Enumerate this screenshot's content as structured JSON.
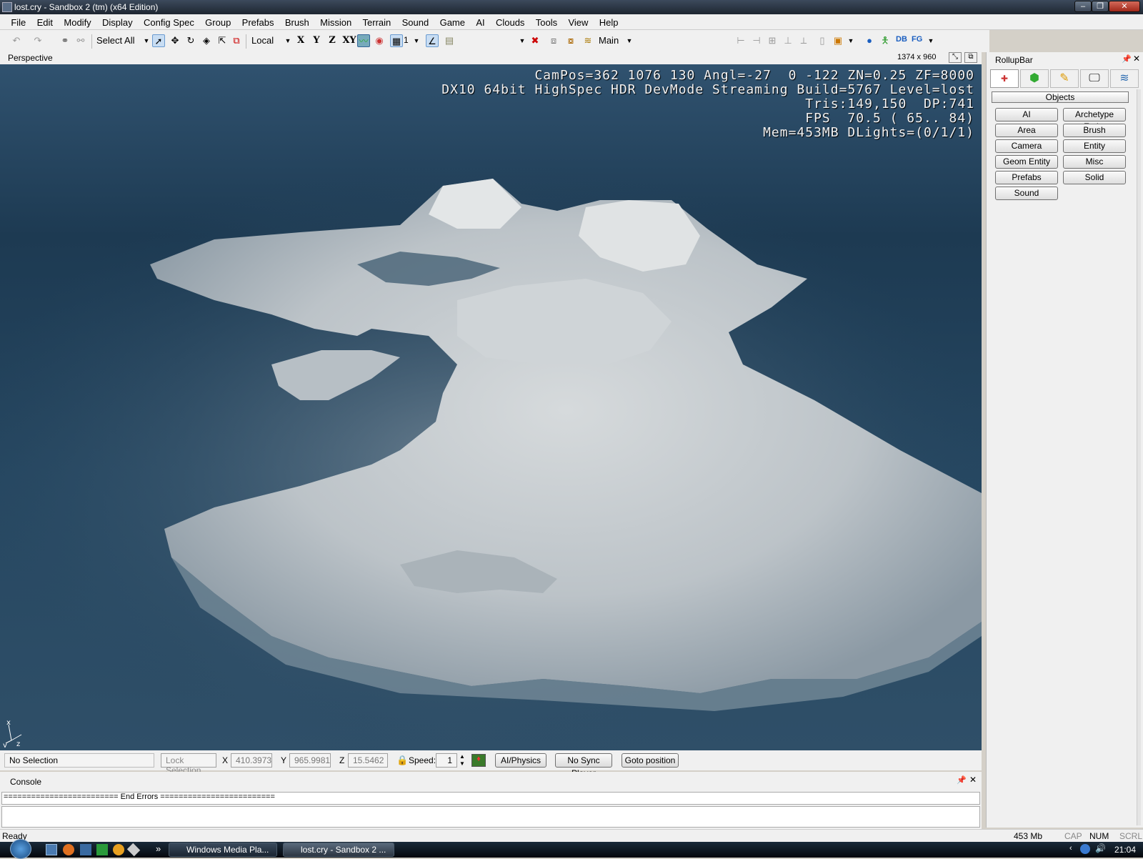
{
  "window": {
    "title": "lost.cry - Sandbox 2 (tm) (x64 Edition)",
    "minimize": "–",
    "restore": "❐",
    "close": "✕"
  },
  "menu": [
    "File",
    "Edit",
    "Modify",
    "Display",
    "Config Spec",
    "Group",
    "Prefabs",
    "Brush",
    "Mission",
    "Terrain",
    "Sound",
    "Game",
    "AI",
    "Clouds",
    "Tools",
    "View",
    "Help"
  ],
  "toolbar": {
    "select_all": "Select All",
    "coord_system": "Local",
    "axis_x": "X",
    "axis_y": "Y",
    "axis_z": "Z",
    "axis_xy": "XY",
    "snap_value": "1",
    "layer": "Main",
    "db": "DB",
    "fg": "FG"
  },
  "viewport": {
    "name": "Perspective",
    "resolution": "1374 x 960",
    "osd": [
      "CamPos=362 1076 130 Angl=-27  0 -122 ZN=0.25 ZF=8000",
      "DX10 64bit HighSpec HDR DevMode Streaming Build=5767 Level=lost",
      "Tris:149,150  DP:741",
      "FPS  70.5 ( 65.. 84)",
      "Mem=453MB DLights=(0/1/1)"
    ],
    "gizmo": {
      "x": "x",
      "y": "y",
      "z": "z"
    }
  },
  "status": {
    "selection": "No Selection",
    "lock_selection": "Lock Selection",
    "x_label": "X",
    "x_value": "410.3973",
    "y_label": "Y",
    "y_value": "965.9981",
    "z_label": "Z",
    "z_value": "15.5462",
    "speed_label": "Speed:",
    "speed_value": "1",
    "ai_physics": "AI/Physics",
    "no_sync_player": "No Sync Player",
    "goto_position": "Goto position"
  },
  "console": {
    "title": "Console",
    "line": "========================= End Errors ========================="
  },
  "rollup": {
    "title": "RollupBar",
    "section": "Objects",
    "buttons_left": [
      "AI",
      "Area",
      "Camera",
      "Geom Entity",
      "Prefabs",
      "Sound"
    ],
    "buttons_right": [
      "Archetype Entity",
      "Brush",
      "Entity",
      "Misc",
      "Solid"
    ]
  },
  "readybar": {
    "status": "Ready",
    "memory": "453 Mb",
    "cap": "CAP",
    "num": "NUM",
    "scrl": "SCRL"
  },
  "taskbar": {
    "more": "»",
    "tasks": [
      "Windows Media Pla...",
      "lost.cry - Sandbox 2 ..."
    ],
    "clock": "21:04"
  },
  "colors": {
    "water": "#1f3a52",
    "terrain": "#c6cbcf",
    "osd_text": "#f2f2f2"
  }
}
